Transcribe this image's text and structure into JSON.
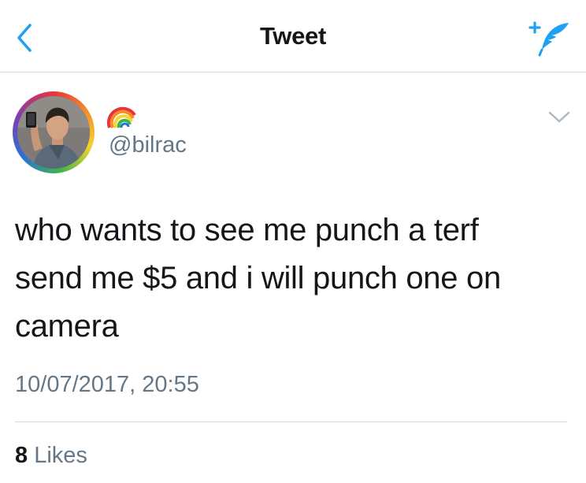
{
  "header": {
    "title": "Tweet",
    "back_icon": "chevron-left-icon",
    "compose_icon": "compose-tweet-icon",
    "accent_color": "#1da1f2"
  },
  "tweet": {
    "display_name_emoji": "rainbow-emoji",
    "handle": "@bilrac",
    "menu_icon": "chevron-down-icon",
    "text_lines": [
      "who wants to see me punch a terf",
      "send me $5 and i will punch one on",
      "camera"
    ],
    "timestamp": "10/07/2017, 20:55",
    "likes_count": "8",
    "likes_label": "Likes"
  }
}
